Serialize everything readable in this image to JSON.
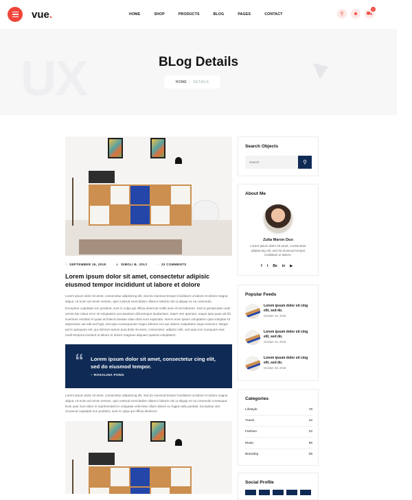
{
  "brand": {
    "logo_text": "vue",
    "logo_dot": ".",
    "accent": "#f0453a",
    "navy": "#0f2b55"
  },
  "nav": {
    "items": [
      "HOME",
      "SHOP",
      "PRODUCTS",
      "BLOG",
      "PAGES",
      "CONTACT"
    ]
  },
  "header_icons": {
    "search": "search-icon",
    "user": "user-icon",
    "cart": "cart-icon",
    "cart_count": "0"
  },
  "hero": {
    "bg_word": "UX",
    "title": "BLog Details",
    "crumb_home": "HOME",
    "crumb_current": "DETAILS"
  },
  "post": {
    "date": "SEPTEMBER 15, 2018",
    "author": "DIBOLI B. JOLY",
    "comments": "23 COMMENTS",
    "title": "Lorem ipsum dolor sit amet, consectetur adipisic eiusmod tempor incididunt ut labore et dolore",
    "para1": "Lorem ipsum dolor sit amet, consectetur adipisicing elit, sed do eiusmod tempor incididunt ut labore et dolore magna aliqua. Ut enim ad minim veniam, quis nostrud exercitation ullamco laboris nisi ut aliquip ex ea commodo.",
    "para2": "Excepteur cupidatat non proident, sunt in culpa qui officia deserunt mollit anim id est laborum. Sed ut perspiciatis unde omnis iste natus error sit voluptatem accusantium doloremque laudantium, totam rem aperiam, eaque ipsa quae ab illo inventore veritatis et quasi architecto beatae vitae dicta sunt explicabo. Nemo enim ipsam voluptatem quia voluptas sit aspernatur aut odit aut fugit, sed quia consequuntur magni dolores eos qui ratione voluptatem sequi nesciunt. Neque porro quisquam est, qui dolorem ipsum quia dolor sit amet, consectetur, adipisci velit, sed quia non numquam eius modi tempora incidunt ut labore et dolore magnam aliquam quaerat voluptatem.",
    "quote": "Lorem ipsum dolor sit amet, consectetur cing elit, sed do eiusmod tempor.",
    "quote_author": "– ROSALINA PONG",
    "para3": "Lorem ipsum dolor sit amet, consectetur adipisicing elit, sed do eiusmod tempor incididunt ut labore et dolore magna aliqua. Ut enim ad minim veniam, quis nostrud exercitation ullamco laboris nisi ut aliquip ex ea commodo consequat. Duis aute irure dolor in reprehenderit in voluptate velit esse cillum dolore eu fugiat nulla pariatur. Excepteur sint occaecat cupidatat non proident, sunt in culpa qui officia deserunt."
  },
  "sidebar": {
    "search_title": "Search Objects",
    "search_placeholder": "Search",
    "about_title": "About Me",
    "about_name": "Zulia Maron Duo",
    "about_text": "Lorem ipsum dolor sit amet, consectetur adipisicing elit, sed do eiusmod tempor incididunt ut labore.",
    "social_icons": [
      "f",
      "t",
      "Be",
      "in",
      "▶"
    ],
    "feeds_title": "Popular Feeds",
    "feeds": [
      {
        "title": "Lorem ipsum dolor sit cing elit, sed do.",
        "date": "October 16, 2018"
      },
      {
        "title": "Lorem ipsum dolor sit cing elit, sed do.",
        "date": "October 24, 2018"
      },
      {
        "title": "Lorem ipsum dolor sit cing elit, sed do.",
        "date": "October 28, 2018"
      }
    ],
    "categories_title": "Categories",
    "categories": [
      {
        "name": "Lifestyle",
        "count": "78"
      },
      {
        "name": "Travel",
        "count": "42"
      },
      {
        "name": "Fashion",
        "count": "32"
      },
      {
        "name": "Music",
        "count": "85"
      },
      {
        "name": "Branding",
        "count": "05"
      }
    ],
    "social_profile_title": "Social Profile"
  }
}
